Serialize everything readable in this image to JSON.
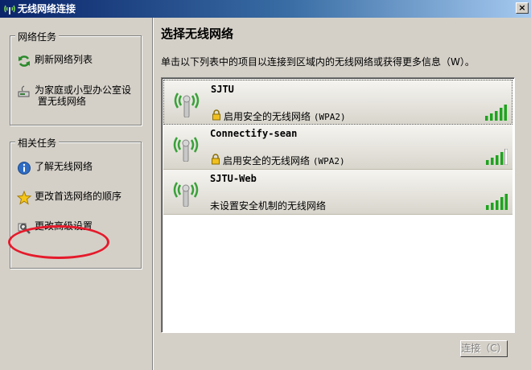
{
  "window": {
    "title": "无线网络连接",
    "close_glyph": "×"
  },
  "left": {
    "network_tasks": {
      "title": "网络任务",
      "items": [
        {
          "label": "刷新网络列表",
          "icon": "refresh-icon"
        },
        {
          "label_line1": "为家庭或小型办公室设",
          "label_line2": "置无线网络",
          "icon": "setup-network-icon"
        }
      ]
    },
    "related_tasks": {
      "title": "相关任务",
      "items": [
        {
          "label": "了解无线网络",
          "icon": "info-icon"
        },
        {
          "label": "更改首选网络的顺序",
          "icon": "star-icon"
        },
        {
          "label": "更改高级设置",
          "icon": "settings-icon"
        }
      ]
    }
  },
  "main": {
    "heading": "选择无线网络",
    "intro": "单击以下列表中的项目以连接到区域内的无线网络或获得更多信息（W）。",
    "networks": [
      {
        "name": "SJTU",
        "status": "启用安全的无线网络",
        "security": "(WPA2)",
        "secured": true,
        "signal_bars": 5
      },
      {
        "name": "Connectify-sean",
        "status": "启用安全的无线网络",
        "security": "(WPA2)",
        "secured": true,
        "signal_bars": 4
      },
      {
        "name": "SJTU-Web",
        "status": "未设置安全机制的无线网络",
        "security": "",
        "secured": false,
        "signal_bars": 5
      }
    ],
    "connect_label": "连接（C）"
  },
  "colors": {
    "signal_green": "#1fa31f",
    "highlight_oval": "#e51a2b",
    "title_bar": "#0a246a"
  }
}
